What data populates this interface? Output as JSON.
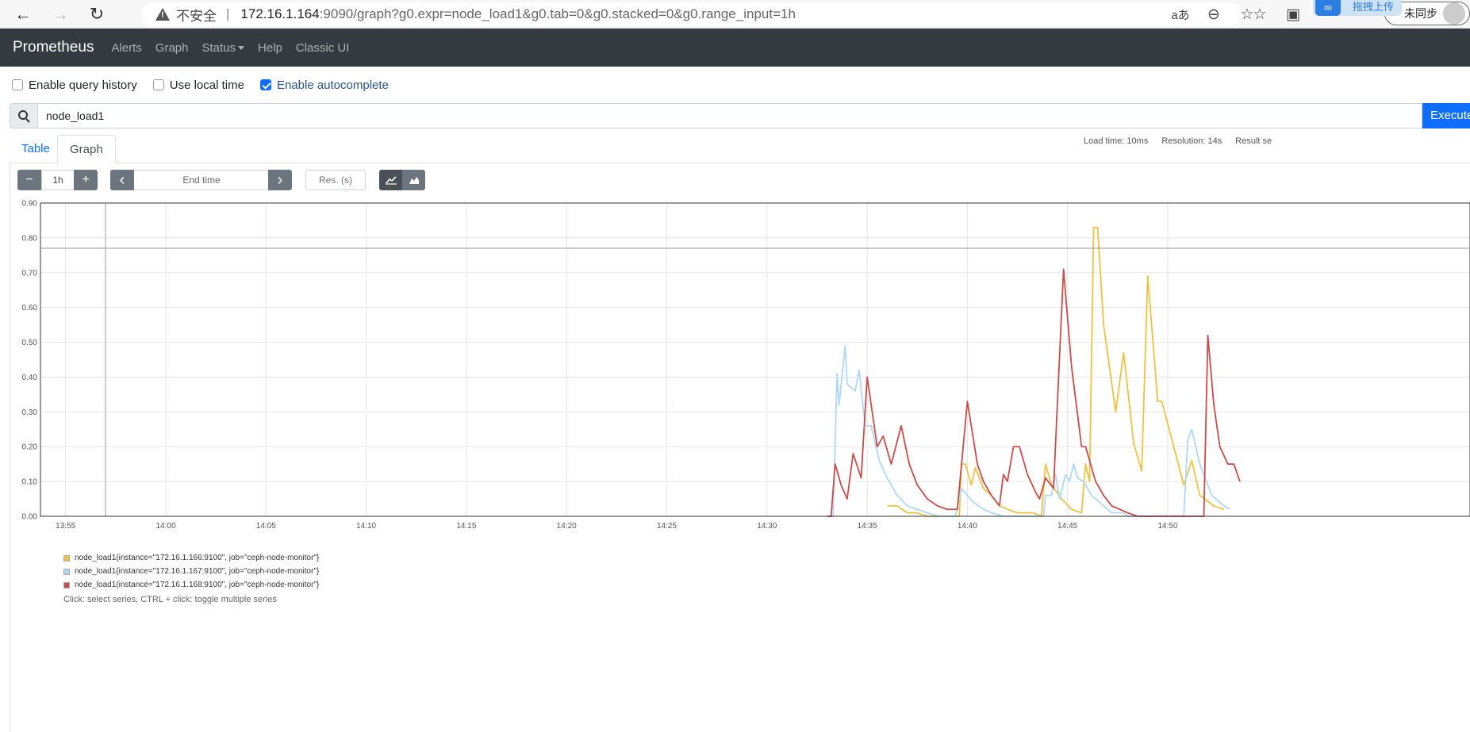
{
  "browser": {
    "back_icon": "←",
    "forward_icon": "→",
    "reload_icon": "↻",
    "insecure_label": "不安全",
    "separator": "|",
    "url_host": "172.16.1.164",
    "url_rest": ":9090/graph?g0.expr=node_load1&g0.tab=0&g0.stacked=0&g0.range_input=1h",
    "read_aloud_icon": "aあ",
    "zoom_icon": "⊖",
    "favorite_add_icon": "☆",
    "favorites_icon": "☆",
    "collections_icon": "▣",
    "extensions_icon": "◔",
    "upload_badge": "拖拽上传",
    "sync_label": "未同步"
  },
  "app": {
    "brand": "Prometheus",
    "nav": [
      "Alerts",
      "Graph",
      "Status",
      "Help",
      "Classic UI"
    ]
  },
  "options": {
    "query_history": "Enable query history",
    "local_time": "Use local time",
    "autocomplete": "Enable autocomplete"
  },
  "query": {
    "expression": "node_load1",
    "execute_label": "Execute"
  },
  "tabs": [
    "Table",
    "Graph"
  ],
  "stats": {
    "load_time": "Load time: 10ms",
    "resolution": "Resolution: 14s",
    "result_series": "Result se"
  },
  "controls": {
    "minus": "−",
    "range": "1h",
    "plus": "+",
    "prev": "‹",
    "end_time_placeholder": "End time",
    "next": "›",
    "res_placeholder": "Res. (s)"
  },
  "chart_data": {
    "type": "line",
    "y_ticks": [
      "0.00",
      "0.10",
      "0.20",
      "0.30",
      "0.40",
      "0.50",
      "0.60",
      "0.70",
      "0.80",
      "0.90"
    ],
    "x_ticks": [
      "13:55",
      "14:00",
      "14:05",
      "14:10",
      "14:15",
      "14:20",
      "14:25",
      "14:30",
      "14:35",
      "14:40",
      "14:45",
      "14:50"
    ],
    "ylim": [
      0,
      0.9
    ],
    "x_range_minutes": [
      -1.25,
      17.8
    ],
    "x_unit": "minutes relative to 14:35 on the printed time axis",
    "grid": true,
    "series": [
      {
        "name": "node_load1{instance=\"172.16.1.166:9100\", job=\"ceph-node-monitor\"}",
        "color": "#edc240",
        "points": [
          [
            36.0,
            0.03
          ],
          [
            36.5,
            0.03
          ],
          [
            37.0,
            0.01
          ],
          [
            37.5,
            0.01
          ],
          [
            38.0,
            0.0
          ],
          [
            39.6,
            0.0
          ],
          [
            39.7,
            0.15
          ],
          [
            39.9,
            0.15
          ],
          [
            40.2,
            0.09
          ],
          [
            40.4,
            0.14
          ],
          [
            40.8,
            0.08
          ],
          [
            41.2,
            0.06
          ],
          [
            41.6,
            0.03
          ],
          [
            42.0,
            0.02
          ],
          [
            42.5,
            0.01
          ],
          [
            43.3,
            0.01
          ],
          [
            43.7,
            0.0
          ],
          [
            43.9,
            0.15
          ],
          [
            44.2,
            0.09
          ],
          [
            44.7,
            0.05
          ],
          [
            45.2,
            0.02
          ],
          [
            45.7,
            0.01
          ],
          [
            45.9,
            0.15
          ],
          [
            46.1,
            0.1
          ],
          [
            46.3,
            0.83
          ],
          [
            46.5,
            0.83
          ],
          [
            46.8,
            0.55
          ],
          [
            47.4,
            0.3
          ],
          [
            47.8,
            0.47
          ],
          [
            48.3,
            0.21
          ],
          [
            48.7,
            0.13
          ],
          [
            49.0,
            0.69
          ],
          [
            49.5,
            0.33
          ],
          [
            49.7,
            0.33
          ],
          [
            50.3,
            0.2
          ],
          [
            50.8,
            0.09
          ],
          [
            51.2,
            0.16
          ],
          [
            51.6,
            0.06
          ],
          [
            52.3,
            0.03
          ],
          [
            52.8,
            0.02
          ]
        ]
      },
      {
        "name": "node_load1{instance=\"172.16.1.167:9100\", job=\"ceph-node-monitor\"}",
        "color": "#afd8f8",
        "points": [
          [
            33.0,
            0.0
          ],
          [
            33.3,
            0.0
          ],
          [
            33.5,
            0.41
          ],
          [
            33.6,
            0.32
          ],
          [
            33.9,
            0.49
          ],
          [
            34.0,
            0.38
          ],
          [
            34.4,
            0.36
          ],
          [
            34.6,
            0.42
          ],
          [
            34.9,
            0.26
          ],
          [
            35.2,
            0.26
          ],
          [
            35.6,
            0.16
          ],
          [
            36.0,
            0.11
          ],
          [
            36.5,
            0.06
          ],
          [
            37.0,
            0.03
          ],
          [
            37.5,
            0.02
          ],
          [
            38.0,
            0.01
          ],
          [
            38.6,
            0.0
          ],
          [
            39.4,
            0.0
          ],
          [
            39.7,
            0.08
          ],
          [
            40.3,
            0.04
          ],
          [
            40.8,
            0.02
          ],
          [
            41.2,
            0.01
          ],
          [
            41.8,
            0.0
          ],
          [
            43.8,
            0.0
          ],
          [
            43.9,
            0.06
          ],
          [
            44.2,
            0.06
          ],
          [
            44.4,
            0.12
          ],
          [
            44.6,
            0.05
          ],
          [
            44.9,
            0.12
          ],
          [
            45.1,
            0.1
          ],
          [
            45.3,
            0.15
          ],
          [
            45.5,
            0.11
          ],
          [
            45.8,
            0.1
          ],
          [
            46.2,
            0.06
          ],
          [
            46.8,
            0.03
          ],
          [
            47.2,
            0.01
          ],
          [
            47.8,
            0.01
          ],
          [
            48.0,
            0.0
          ],
          [
            50.8,
            0.0
          ],
          [
            51.0,
            0.22
          ],
          [
            51.2,
            0.25
          ],
          [
            51.6,
            0.15
          ],
          [
            52.2,
            0.06
          ],
          [
            52.8,
            0.03
          ],
          [
            53.1,
            0.02
          ]
        ]
      },
      {
        "name": "node_load1{instance=\"172.16.1.168:9100\", job=\"ceph-node-monitor\"}",
        "color": "#cb4b4b",
        "points": [
          [
            33.0,
            0.0
          ],
          [
            33.2,
            0.0
          ],
          [
            33.4,
            0.15
          ],
          [
            33.7,
            0.09
          ],
          [
            34.0,
            0.05
          ],
          [
            34.3,
            0.18
          ],
          [
            34.7,
            0.11
          ],
          [
            35.0,
            0.4
          ],
          [
            35.5,
            0.2
          ],
          [
            35.8,
            0.23
          ],
          [
            36.2,
            0.15
          ],
          [
            36.7,
            0.26
          ],
          [
            37.1,
            0.15
          ],
          [
            37.5,
            0.09
          ],
          [
            38.0,
            0.05
          ],
          [
            38.5,
            0.03
          ],
          [
            39.0,
            0.02
          ],
          [
            39.5,
            0.02
          ],
          [
            40.0,
            0.33
          ],
          [
            40.5,
            0.15
          ],
          [
            40.8,
            0.1
          ],
          [
            41.2,
            0.06
          ],
          [
            41.6,
            0.03
          ],
          [
            41.8,
            0.12
          ],
          [
            42.0,
            0.1
          ],
          [
            42.3,
            0.2
          ],
          [
            42.6,
            0.2
          ],
          [
            43.0,
            0.12
          ],
          [
            43.4,
            0.07
          ],
          [
            43.6,
            0.05
          ],
          [
            43.9,
            0.11
          ],
          [
            44.3,
            0.08
          ],
          [
            44.8,
            0.71
          ],
          [
            45.2,
            0.43
          ],
          [
            45.7,
            0.2
          ],
          [
            45.9,
            0.2
          ],
          [
            46.4,
            0.1
          ],
          [
            46.8,
            0.06
          ],
          [
            47.2,
            0.03
          ],
          [
            47.6,
            0.02
          ],
          [
            48.0,
            0.01
          ],
          [
            48.5,
            0.0
          ],
          [
            51.8,
            0.0
          ],
          [
            52.0,
            0.52
          ],
          [
            52.3,
            0.32
          ],
          [
            52.6,
            0.2
          ],
          [
            53.0,
            0.15
          ],
          [
            53.3,
            0.15
          ],
          [
            53.6,
            0.1
          ]
        ]
      }
    ]
  },
  "legend_hint": "Click: select series, CTRL + click: toggle multiple series"
}
